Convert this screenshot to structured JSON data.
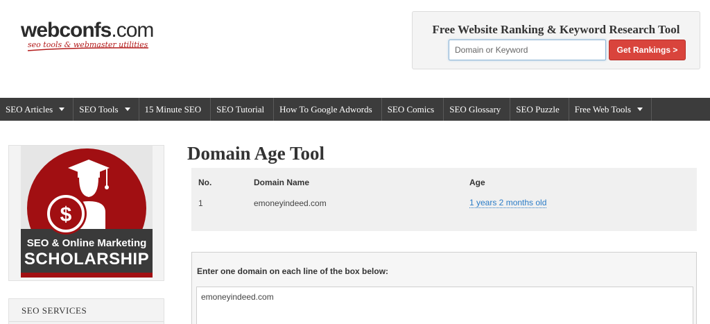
{
  "logo": {
    "name": "webconfs",
    "tld": ".com",
    "tagline": "seo tools & webmaster utilities"
  },
  "search": {
    "title": "Free Website Ranking & Keyword Research Tool",
    "placeholder": "Domain or Keyword",
    "button_label": "Get Rankings >"
  },
  "nav": {
    "items": [
      {
        "label": "SEO Articles"
      },
      {
        "label": "SEO Tools"
      },
      {
        "label": "15 Minute SEO"
      },
      {
        "label": "SEO Tutorial"
      },
      {
        "label": "How To Google Adwords"
      },
      {
        "label": "SEO Comics"
      },
      {
        "label": "SEO Glossary"
      },
      {
        "label": "SEO Puzzle"
      },
      {
        "label": "Free Web Tools"
      }
    ]
  },
  "sidebar": {
    "promo_line1": "SEO & Online Marketing",
    "promo_line2": "SCHOLARSHIP",
    "services_title": "SEO SERVICES"
  },
  "main": {
    "title": "Domain Age Tool",
    "table": {
      "headers": [
        "No.",
        "Domain Name",
        "Age"
      ],
      "rows": [
        {
          "no": "1",
          "domain": "emoneyindeed.com",
          "age": "1 years 2 months old"
        }
      ]
    },
    "input_label": "Enter one domain on each line of the box below:",
    "textarea_value": "emoneyindeed.com"
  },
  "colors": {
    "nav_bg": "#3c3c3c",
    "accent_red": "#d9443c",
    "link_blue": "#2a7cc7",
    "promo_red": "#a10f12"
  }
}
